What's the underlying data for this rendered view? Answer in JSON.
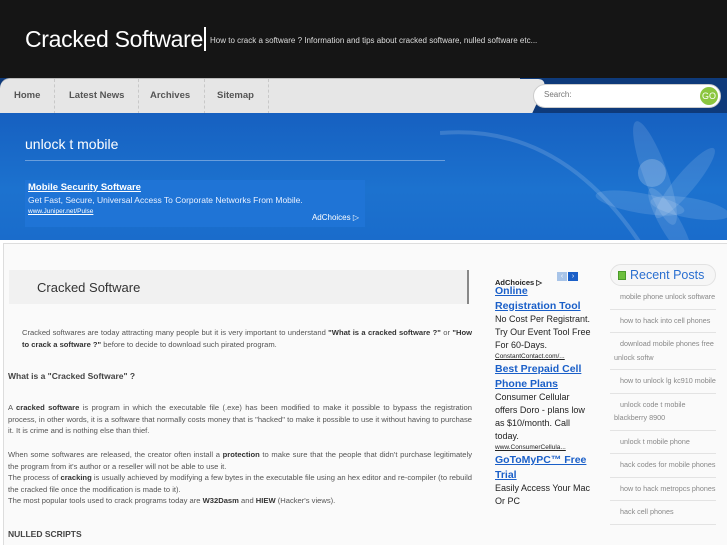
{
  "header": {
    "site_title": "Cracked Software",
    "tagline": "How to crack a software ? Information and tips about cracked software, nulled software etc..."
  },
  "nav": {
    "items": [
      "Home",
      "Latest News",
      "Archives",
      "Sitemap"
    ],
    "search_placeholder": "Search:",
    "go_label": "GO"
  },
  "banner": {
    "page_title": "unlock t mobile",
    "ad": {
      "title": "Mobile Security Software",
      "desc": "Get Fast, Secure, Universal Access To Corporate Networks From Mobile.",
      "url": "www.Juniper.net/Pulse",
      "choices": "AdChoices ▷"
    }
  },
  "content": {
    "heading": "Cracked Software",
    "intro": [
      "Cracked softwares are today attracting many people but it is very important to understand ",
      "\"What is a cracked software ?\"",
      " or ",
      "\"How to crack a software ?\"",
      " before to decide to download such pirated program."
    ],
    "h_what": "What is a \"Cracked Software\" ?",
    "p1": [
      "A ",
      "cracked software",
      " is program in which the executable file (.exe) has been modified to make it possible to bypass the registration process, in other words, it is a software that normally costs money that is \"hacked\" to make it possible to use it without having to purchase it. It is crime and is nothing else than thief."
    ],
    "p2": [
      "When some softwares are released, the creator often install a ",
      "protection",
      " to make sure that the people that didn't purchase legitimately the program from it's author or a reseller will not be able to use it."
    ],
    "p3": [
      "The process of ",
      "cracking",
      " is usually achieved by modifying a few bytes in the executable file using an hex editor and re-compiler (to rebuild the cracked file once the modification is made to it)."
    ],
    "p4": [
      "The most popular tools used to crack programs today are ",
      "W32Dasm",
      " and ",
      "HIEW",
      " (Hacker's views)."
    ],
    "h_nulled": "NULLED SCRIPTS"
  },
  "ads": {
    "choices": "AdChoices ▷",
    "items": [
      {
        "title": "Online Registration Tool",
        "desc": "No Cost Per Registrant. Try Our Event Tool Free For 60-Days.",
        "url": "ConstantContact.com/..."
      },
      {
        "title": "Best Prepaid Cell Phone Plans",
        "desc": "Consumer Cellular offers Doro - plans low as $10/month. Call today.",
        "url": "www.ConsumerCellula..."
      },
      {
        "title": "GoToMyPC™ Free Trial",
        "desc": "Easily Access Your Mac Or PC"
      }
    ]
  },
  "sidebar": {
    "title": "Recent Posts",
    "posts": [
      "mobile phone unlock software",
      "how to hack into cell phones",
      "download mobile phones free unlock softw",
      "how to unlock lg kc910 mobile",
      "unlock code t mobile blackberry 8900",
      "unlock t mobile phone",
      "hack codes for mobile phones",
      "how to hack metropcs phones",
      "hack cell phones"
    ]
  }
}
